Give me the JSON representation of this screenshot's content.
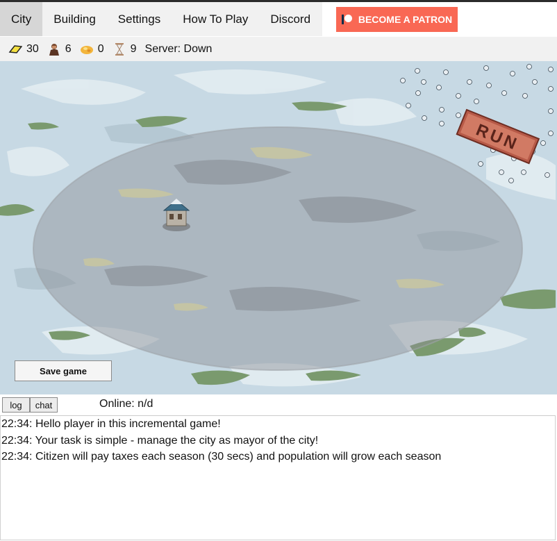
{
  "nav": {
    "tabs": [
      {
        "label": "City",
        "active": true
      },
      {
        "label": "Building"
      },
      {
        "label": "Settings"
      },
      {
        "label": "How To Play"
      },
      {
        "label": "Discord"
      }
    ],
    "patron_label": "BECOME A PATRON",
    "patron_color": "#f96854"
  },
  "resources": {
    "gold": "30",
    "population": "6",
    "food": "0",
    "time": "9",
    "server_status": "Server: Down"
  },
  "map": {
    "sign_text": "RUN"
  },
  "save_label": "Save game",
  "chat": {
    "log_tab": "log",
    "chat_tab": "chat",
    "online": "Online: n/d"
  },
  "log": [
    {
      "time": "22:34:",
      "text": "Hello player in this incremental game!"
    },
    {
      "time": "22:34:",
      "text": "Your task is simple - manage the city as mayor of the city!"
    },
    {
      "time": "22:34:",
      "text": "Citizen will pay taxes each season (30 secs) and population will grow each season"
    }
  ]
}
